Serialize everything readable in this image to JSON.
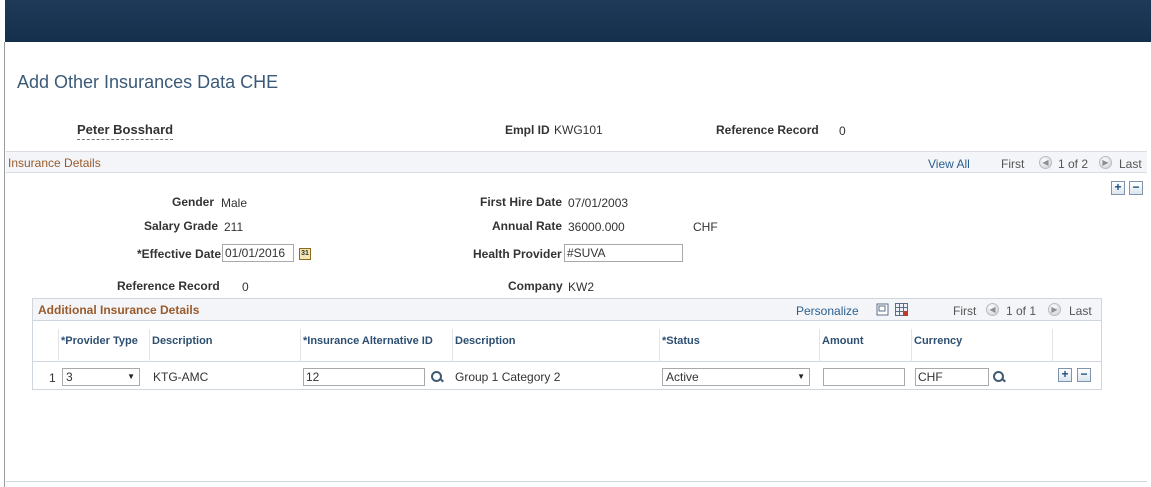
{
  "page": {
    "title": "Add Other Insurances Data CHE"
  },
  "employee": {
    "name": "Peter Bosshard",
    "empl_id_label": "Empl ID",
    "empl_id": "KWG101",
    "ref_record_label": "Reference Record",
    "ref_record": "0"
  },
  "insurance_details": {
    "title": "Insurance Details",
    "view_all": "View All",
    "first": "First",
    "pager": "1 of 2",
    "last": "Last",
    "gender_label": "Gender",
    "gender": "Male",
    "first_hire_label": "First Hire Date",
    "first_hire": "07/01/2003",
    "salary_grade_label": "Salary Grade",
    "salary_grade": "211",
    "annual_rate_label": "Annual Rate",
    "annual_rate": "36000.000",
    "annual_rate_currency": "CHF",
    "effective_date_label": "*Effective Date",
    "effective_date": "01/01/2016",
    "health_provider_label": "Health Provider",
    "health_provider": "#SUVA",
    "reference_record_label": "Reference Record",
    "reference_record": "0",
    "company_label": "Company",
    "company": "KW2"
  },
  "additional": {
    "title": "Additional Insurance Details",
    "personalize": "Personalize",
    "first": "First",
    "pager": "1 of 1",
    "last": "Last",
    "columns": {
      "provider_type": "*Provider Type",
      "description": "Description",
      "alt_id": "*Insurance Alternative ID",
      "description2": "Description",
      "status": "*Status",
      "amount": "Amount",
      "currency": "Currency"
    },
    "rows": [
      {
        "num": "1",
        "provider_type": "3",
        "description": "KTG-AMC",
        "alt_id": "12",
        "description2": "Group 1 Category 2",
        "status": "Active",
        "amount": "",
        "currency": "CHF"
      }
    ]
  },
  "icons": {
    "add": "+",
    "remove": "−",
    "prev": "◀",
    "next": "▶",
    "dropdown": "▼",
    "calendar": "31"
  }
}
